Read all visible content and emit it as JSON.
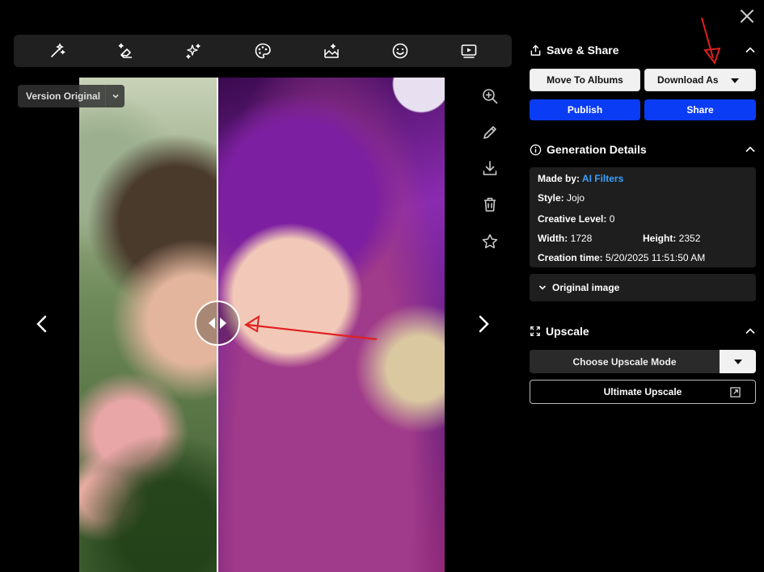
{
  "version_select": {
    "label": "Version Original"
  },
  "save_share": {
    "title": "Save & Share",
    "move_to_albums": "Move To Albums",
    "download_as": "Download As",
    "publish": "Publish",
    "share": "Share"
  },
  "generation_details": {
    "title": "Generation Details",
    "made_by_label": "Made by:",
    "made_by_value": "AI Filters",
    "style_label": "Style:",
    "style_value": "Jojo",
    "creative_label": "Creative Level:",
    "creative_value": "0",
    "width_label": "Width:",
    "width_value": "1728",
    "height_label": "Height:",
    "height_value": "2352",
    "creation_label": "Creation time:",
    "creation_value": "5/20/2025 11:51:50 AM",
    "original_image": "Original image"
  },
  "upscale": {
    "title": "Upscale",
    "choose_mode": "Choose Upscale Mode",
    "ultimate": "Ultimate Upscale"
  },
  "toolbar": {
    "tools": [
      "magic-wand-icon",
      "eraser-sparkle-icon",
      "sparkles-icon",
      "palette-icon",
      "image-edit-icon",
      "smiley-icon",
      "video-play-icon"
    ]
  },
  "colors": {
    "accent_blue": "#0b3cf5",
    "link_blue": "#3aa0ff",
    "annotation_red": "#e02020",
    "panel_bg": "#1e1e1e"
  }
}
